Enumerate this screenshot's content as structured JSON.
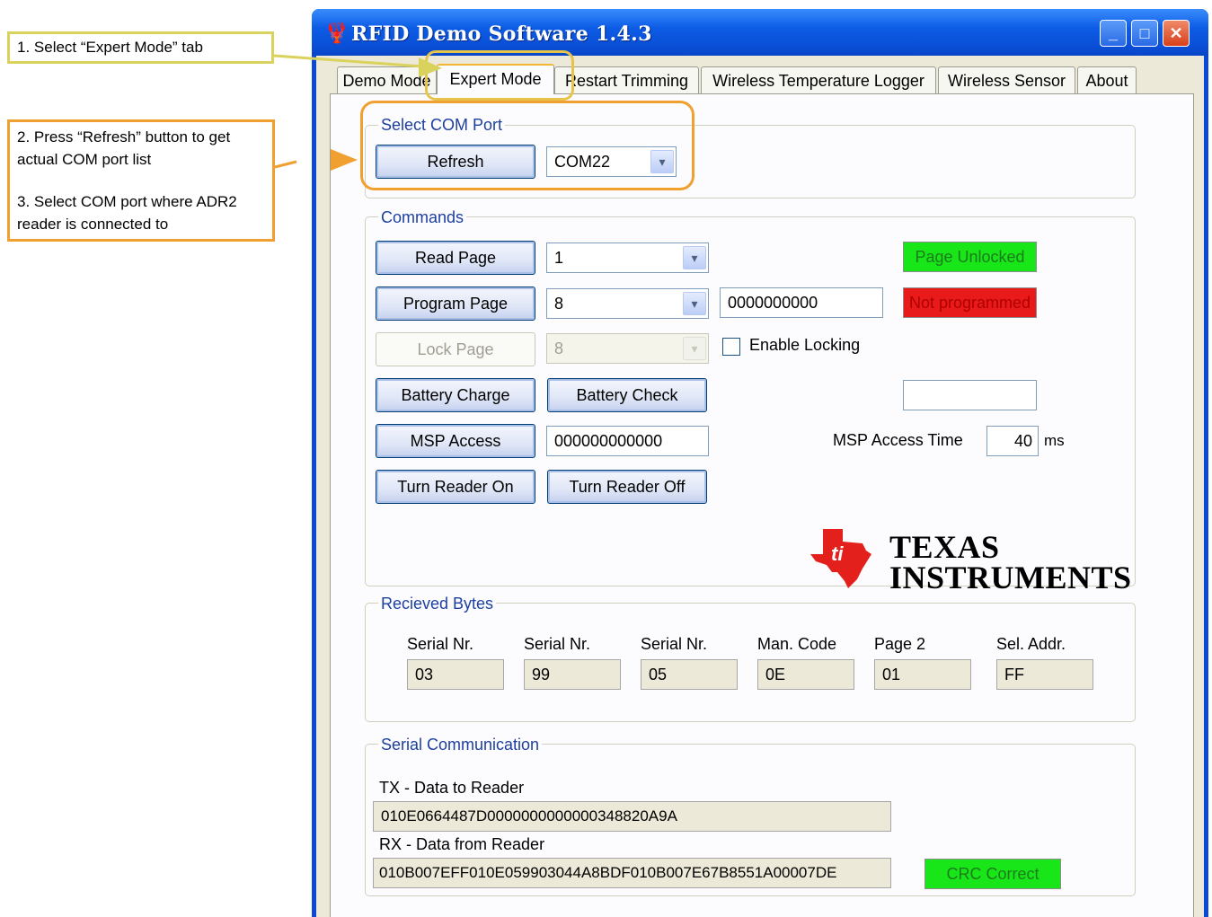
{
  "annotations": {
    "step1": "1. Select “Expert Mode” tab",
    "step2": "2. Press “Refresh” button to get actual COM port list",
    "step3": "3. Select COM port where ADR2 reader is connected to"
  },
  "window": {
    "title": "RFID Demo Software 1.4.3",
    "controls": {
      "minimize": "_",
      "maximize": "□",
      "close": "✕"
    }
  },
  "tabs": [
    {
      "label": "Demo Mode"
    },
    {
      "label": "Expert Mode",
      "active": true
    },
    {
      "label": "Restart Trimming"
    },
    {
      "label": "Wireless Temperature Logger"
    },
    {
      "label": "Wireless Sensor"
    },
    {
      "label": "About"
    }
  ],
  "com_port": {
    "group_title": "Select COM Port",
    "refresh_label": "Refresh",
    "selected": "COM22"
  },
  "commands": {
    "group_title": "Commands",
    "read_page_label": "Read Page",
    "read_page_value": "1",
    "page_status": "Page Unlocked",
    "program_page_label": "Program Page",
    "program_page_value": "8",
    "program_data": "0000000000",
    "program_status": "Not programmed",
    "lock_page_label": "Lock Page",
    "lock_page_value": "8",
    "enable_locking_label": "Enable Locking",
    "enable_locking_checked": false,
    "battery_charge_label": "Battery Charge",
    "battery_check_label": "Battery Check",
    "battery_status": "",
    "msp_access_label": "MSP Access",
    "msp_access_value": "000000000000",
    "msp_access_time_label": "MSP Access Time",
    "msp_access_time_value": "40",
    "msp_access_time_unit": "ms",
    "turn_on_label": "Turn Reader On",
    "turn_off_label": "Turn Reader Off",
    "logo_line1": "TEXAS",
    "logo_line2": "INSTRUMENTS"
  },
  "received": {
    "group_title": "Recieved Bytes",
    "fields": [
      {
        "label": "Serial Nr.",
        "value": "03"
      },
      {
        "label": "Serial Nr.",
        "value": "99"
      },
      {
        "label": "Serial Nr.",
        "value": "05"
      },
      {
        "label": "Man. Code",
        "value": "0E"
      },
      {
        "label": "Page 2",
        "value": "01"
      },
      {
        "label": "Sel. Addr.",
        "value": "FF"
      }
    ]
  },
  "serial": {
    "group_title": "Serial Communication",
    "tx_label": "TX - Data to Reader",
    "tx_value": "010E0664487D0000000000000348820A9A",
    "rx_label": "RX - Data from Reader",
    "rx_value": "010B007EFF010E059903044A8BDF010B007E67B8551A00007DE",
    "crc_status": "CRC Correct"
  },
  "colors": {
    "status_ok": "#19e619",
    "status_error": "#e81a1a",
    "status_ok_text": "#1c7c1c",
    "status_error_text": "#b00000",
    "title_bar": "#0a4fd6"
  }
}
